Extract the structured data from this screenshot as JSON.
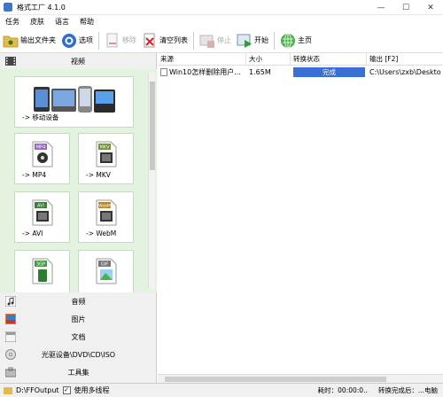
{
  "window": {
    "title": "格式工厂 4.1.0",
    "minimize": "—",
    "maximize": "☐",
    "close": "✕"
  },
  "menu": [
    "任务",
    "皮肤",
    "语言",
    "帮助"
  ],
  "toolbar": {
    "output_folder": "输出文件夹",
    "options": "选项",
    "remove": "移除",
    "clear_list": "清空列表",
    "stop": "停止",
    "start": "开始",
    "home": "主页"
  },
  "sidebar": {
    "video_label": "视频",
    "tiles": [
      {
        "label": "-> 移动设备",
        "badge": ""
      },
      {
        "label": "-> MP4",
        "badge": "MP4"
      },
      {
        "label": "-> MKV",
        "badge": "MKV"
      },
      {
        "label": "-> AVI",
        "badge": "AVI"
      },
      {
        "label": "-> WebM",
        "badge": "WebM"
      },
      {
        "label": "",
        "badge": "3GP"
      },
      {
        "label": "",
        "badge": "GIF"
      }
    ],
    "categories": [
      "音频",
      "图片",
      "文档",
      "光驱设备\\DVD\\CD\\ISO",
      "工具集"
    ]
  },
  "table": {
    "headers": [
      "来源",
      "大小",
      "转换状态",
      "输出 [F2]"
    ],
    "rows": [
      {
        "source": "Win10怎样删除用户...",
        "size": "1.65M",
        "status": "完成",
        "output": "C:\\Users\\zxb\\Deskto"
      }
    ]
  },
  "statusbar": {
    "output_path": "D:\\FFOutput",
    "multithread_label": "使用多线程",
    "multithread_checked": "✓",
    "elapsed": "耗时：00:00:0..",
    "after_convert": "转换完成后：...电脑"
  },
  "colors": {
    "accent": "#3a6fd6",
    "video_bg": "#e4f2e0",
    "start_green": "#2e9e3a"
  }
}
